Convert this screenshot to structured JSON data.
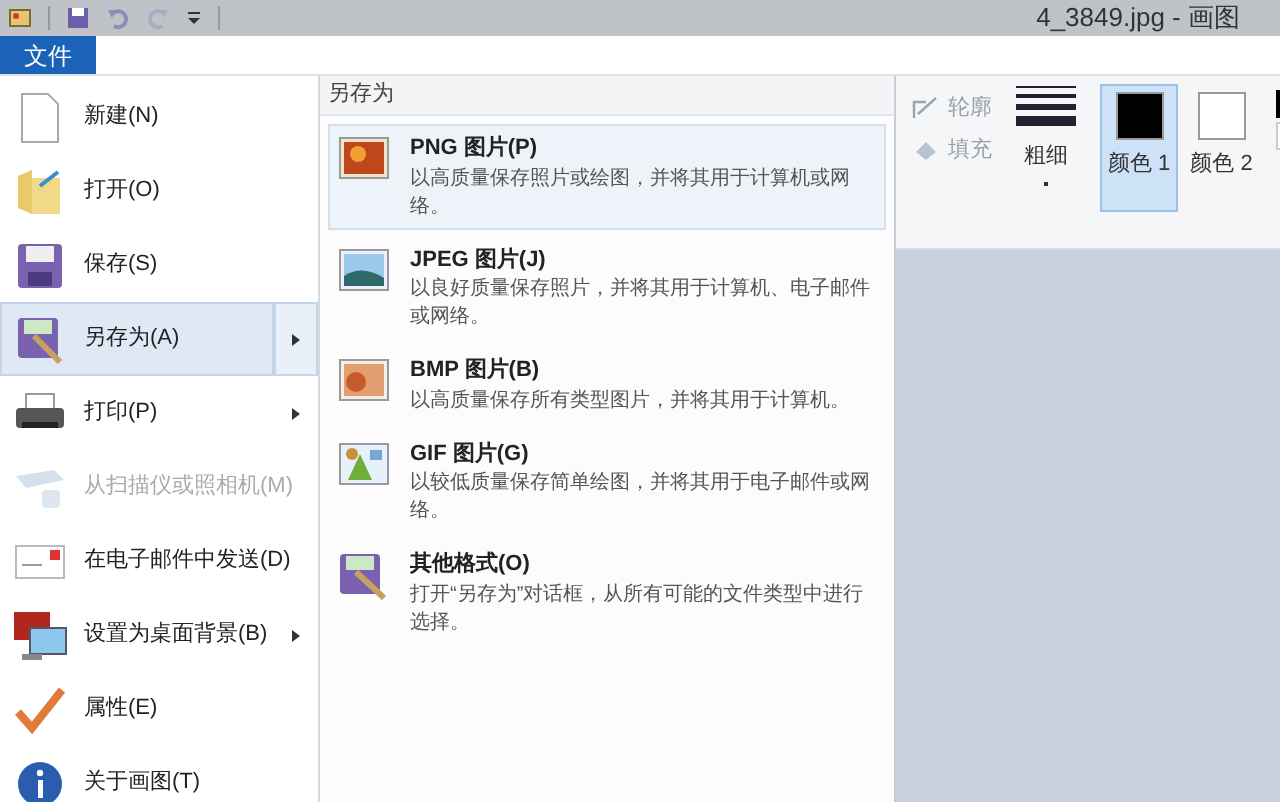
{
  "window": {
    "title": "4_3849.jpg - 画图"
  },
  "file_tab": {
    "label": "文件",
    "selected": true
  },
  "menu": [
    {
      "label": "新建(N)",
      "selected": false,
      "disabled": false,
      "submenu": false
    },
    {
      "label": "打开(O)",
      "selected": false,
      "disabled": false,
      "submenu": false
    },
    {
      "label": "保存(S)",
      "selected": false,
      "disabled": false,
      "submenu": false
    },
    {
      "label": "另存为(A)",
      "selected": true,
      "disabled": false,
      "submenu": true
    },
    {
      "label": "打印(P)",
      "selected": false,
      "disabled": false,
      "submenu": true
    },
    {
      "label": "从扫描仪或照相机(M)",
      "selected": false,
      "disabled": true,
      "submenu": false
    },
    {
      "label": "在电子邮件中发送(D)",
      "selected": false,
      "disabled": false,
      "submenu": false
    },
    {
      "label": "设置为桌面背景(B)",
      "selected": false,
      "disabled": false,
      "submenu": true
    },
    {
      "label": "属性(E)",
      "selected": false,
      "disabled": false,
      "submenu": false
    },
    {
      "label": "关于画图(T)",
      "selected": false,
      "disabled": false,
      "submenu": false
    }
  ],
  "save_as": {
    "heading": "另存为",
    "options": [
      {
        "title": "PNG 图片(P)",
        "description": "以高质量保存照片或绘图，并将其用于计算机或网络。",
        "selected": true
      },
      {
        "title": "JPEG 图片(J)",
        "description": "以良好质量保存照片，并将其用于计算机、电子邮件或网络。",
        "selected": false
      },
      {
        "title": "BMP 图片(B)",
        "description": "以高质量保存所有类型图片，并将其用于计算机。",
        "selected": false
      },
      {
        "title": "GIF 图片(G)",
        "description": "以较低质量保存简单绘图，并将其用于电子邮件或网络。",
        "selected": false
      },
      {
        "title": "其他格式(O)",
        "description": "打开“另存为”对话框，从所有可能的文件类型中进行选择。",
        "selected": false
      }
    ]
  },
  "ribbon": {
    "outline": "轮廓",
    "fill": "填充",
    "size": "粗细",
    "colors": [
      {
        "label": "颜色 1",
        "color": "#000000",
        "selected": true
      },
      {
        "label": "颜色 2",
        "color": "#ffffff",
        "selected": false
      }
    ]
  }
}
